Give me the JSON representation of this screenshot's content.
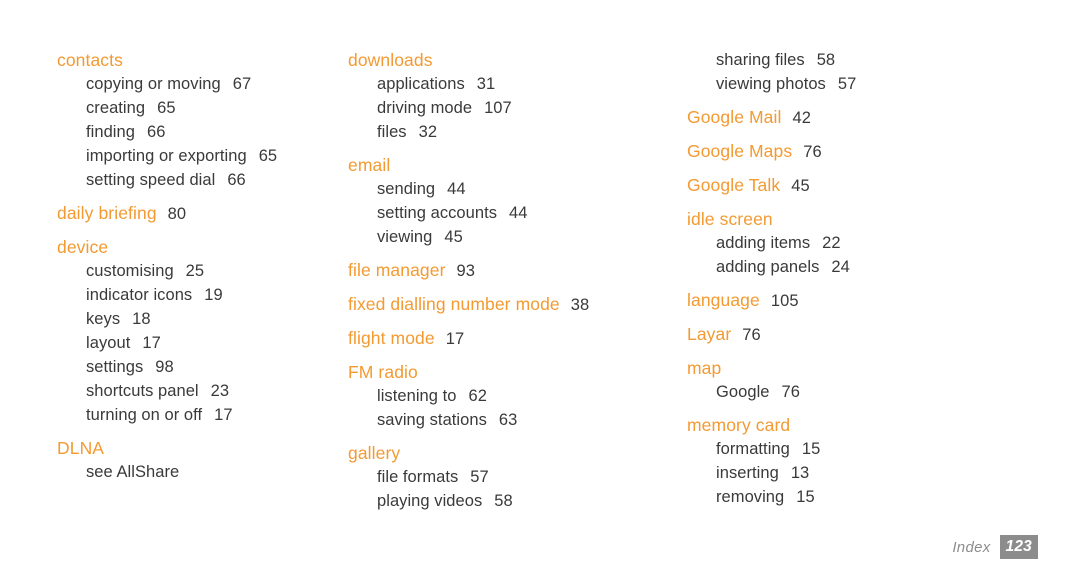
{
  "document": {
    "type": "index-page",
    "footer": {
      "label": "Index",
      "page_number": "123"
    },
    "colors": {
      "heading_orange": "#f39a32",
      "body_text": "#3a3a3a",
      "footer_gray": "#8d8d8d",
      "badge_gray": "#8c8c8c",
      "background": "#ffffff"
    }
  },
  "columns": [
    {
      "id": "column-1",
      "groups": [
        {
          "heading": "contacts",
          "heading_page": "",
          "entries": [
            {
              "label": "copying or moving",
              "page": "67"
            },
            {
              "label": "creating",
              "page": "65"
            },
            {
              "label": "finding",
              "page": "66"
            },
            {
              "label": "importing or exporting",
              "page": "65"
            },
            {
              "label": "setting speed dial",
              "page": "66"
            }
          ]
        },
        {
          "heading": "daily briefing",
          "heading_page": "80",
          "entries": []
        },
        {
          "heading": "device",
          "heading_page": "",
          "entries": [
            {
              "label": "customising",
              "page": "25"
            },
            {
              "label": "indicator icons",
              "page": "19"
            },
            {
              "label": "keys",
              "page": "18"
            },
            {
              "label": "layout",
              "page": "17"
            },
            {
              "label": "settings",
              "page": "98"
            },
            {
              "label": "shortcuts panel",
              "page": "23"
            },
            {
              "label": "turning on or off",
              "page": "17"
            }
          ]
        },
        {
          "heading": "DLNA",
          "heading_page": "",
          "entries": [
            {
              "label": "see AllShare",
              "page": ""
            }
          ]
        }
      ]
    },
    {
      "id": "column-2",
      "groups": [
        {
          "heading": "downloads",
          "heading_page": "",
          "entries": [
            {
              "label": "applications",
              "page": "31"
            },
            {
              "label": "driving mode",
              "page": "107"
            },
            {
              "label": "files",
              "page": "32"
            }
          ]
        },
        {
          "heading": "email",
          "heading_page": "",
          "entries": [
            {
              "label": "sending",
              "page": "44"
            },
            {
              "label": "setting accounts",
              "page": "44"
            },
            {
              "label": "viewing",
              "page": "45"
            }
          ]
        },
        {
          "heading": "file manager",
          "heading_page": "93",
          "entries": []
        },
        {
          "heading": "fixed dialling number mode",
          "heading_page": "38",
          "entries": []
        },
        {
          "heading": "flight mode",
          "heading_page": "17",
          "entries": []
        },
        {
          "heading": "FM radio",
          "heading_page": "",
          "entries": [
            {
              "label": "listening to",
              "page": "62"
            },
            {
              "label": "saving stations",
              "page": "63"
            }
          ]
        },
        {
          "heading": "gallery",
          "heading_page": "",
          "entries": [
            {
              "label": "file formats",
              "page": "57"
            },
            {
              "label": "playing videos",
              "page": "58"
            }
          ]
        }
      ]
    },
    {
      "id": "column-3",
      "groups": [
        {
          "heading": "",
          "heading_page": "",
          "entries": [
            {
              "label": "sharing files",
              "page": "58"
            },
            {
              "label": "viewing photos",
              "page": "57"
            }
          ]
        },
        {
          "heading": "Google Mail",
          "heading_page": "42",
          "entries": []
        },
        {
          "heading": "Google Maps",
          "heading_page": "76",
          "entries": []
        },
        {
          "heading": "Google Talk",
          "heading_page": "45",
          "entries": []
        },
        {
          "heading": "idle screen",
          "heading_page": "",
          "entries": [
            {
              "label": "adding items",
              "page": "22"
            },
            {
              "label": "adding panels",
              "page": "24"
            }
          ]
        },
        {
          "heading": "language",
          "heading_page": "105",
          "entries": []
        },
        {
          "heading": "Layar",
          "heading_page": "76",
          "entries": []
        },
        {
          "heading": "map",
          "heading_page": "",
          "entries": [
            {
              "label": "Google",
              "page": "76"
            }
          ]
        },
        {
          "heading": "memory card",
          "heading_page": "",
          "entries": [
            {
              "label": "formatting",
              "page": "15"
            },
            {
              "label": "inserting",
              "page": "13"
            },
            {
              "label": "removing",
              "page": "15"
            }
          ]
        }
      ]
    }
  ]
}
